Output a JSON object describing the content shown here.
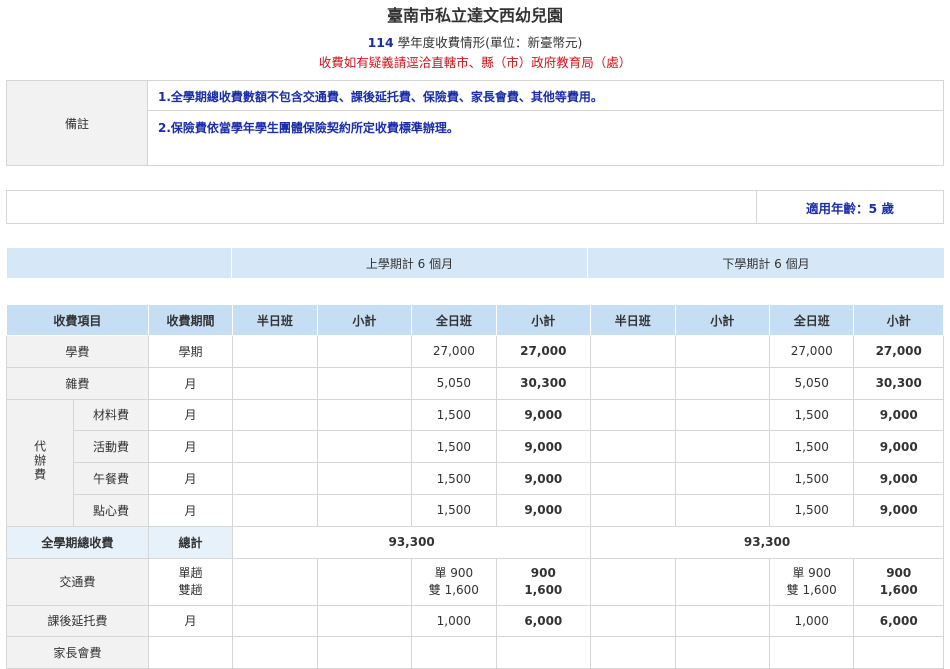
{
  "header": {
    "title": "臺南市私立達文西幼兒園",
    "year": "114",
    "subtitle_rest": " 學年度收費情形(單位：新臺幣元)",
    "notice": "收費如有疑義請逕洽直轄市、縣（市）政府教育局（處）"
  },
  "remarks": {
    "label": "備註",
    "notes": [
      "1.全學期總收費數額不包含交通費、課後延托費、保險費、家長會費、其他等費用。",
      "2.保險費依當學年學生團體保險契約所定收費標準辦理。"
    ]
  },
  "age": {
    "text": "適用年齡：5 歲"
  },
  "semesters": {
    "first": "上學期計  6  個月",
    "second": "下學期計  6  個月"
  },
  "columns": {
    "item": "收費項目",
    "period": "收費期間",
    "half_day": "半日班",
    "subtotal": "小計",
    "full_day": "全日班"
  },
  "rows": {
    "tuition": {
      "label": "學費",
      "period": "學期",
      "s1_full": "27,000",
      "s1_sub": "27,000",
      "s2_full": "27,000",
      "s2_sub": "27,000"
    },
    "misc": {
      "label": "雜費",
      "period": "月",
      "s1_full": "5,050",
      "s1_sub": "30,300",
      "s2_full": "5,050",
      "s2_sub": "30,300"
    },
    "agency_group": "代辦費",
    "materials": {
      "label": "材料費",
      "period": "月",
      "s1_full": "1,500",
      "s1_sub": "9,000",
      "s2_full": "1,500",
      "s2_sub": "9,000"
    },
    "activity": {
      "label": "活動費",
      "period": "月",
      "s1_full": "1,500",
      "s1_sub": "9,000",
      "s2_full": "1,500",
      "s2_sub": "9,000"
    },
    "lunch": {
      "label": "午餐費",
      "period": "月",
      "s1_full": "1,500",
      "s1_sub": "9,000",
      "s2_full": "1,500",
      "s2_sub": "9,000"
    },
    "snack": {
      "label": "點心費",
      "period": "月",
      "s1_full": "1,500",
      "s1_sub": "9,000",
      "s2_full": "1,500",
      "s2_sub": "9,000"
    },
    "total": {
      "label": "全學期總收費",
      "period": "總計",
      "s1_total": "93,300",
      "s2_total": "93,300"
    },
    "transport": {
      "label": "交通費",
      "period_a": "單趟",
      "period_b": "雙趟",
      "s1_full_a": "單 900",
      "s1_full_b": "雙 1,600",
      "s1_sub_a": "900",
      "s1_sub_b": "1,600",
      "s2_full_a": "單 900",
      "s2_full_b": "雙 1,600",
      "s2_sub_a": "900",
      "s2_sub_b": "1,600"
    },
    "afterschool": {
      "label": "課後延托費",
      "period": "月",
      "s1_full": "1,000",
      "s1_sub": "6,000",
      "s2_full": "1,000",
      "s2_sub": "6,000"
    },
    "parents": {
      "label": "家長會費"
    }
  }
}
